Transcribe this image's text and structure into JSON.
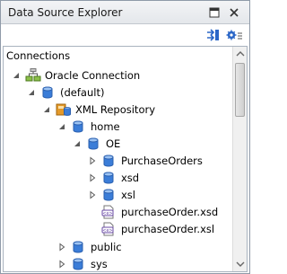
{
  "window": {
    "title": "Data Source Explorer",
    "minimize_icon": "minimize-icon",
    "close_icon": "close-icon"
  },
  "toolbar": {
    "items": [
      {
        "icon": "link-with-editor-icon"
      },
      {
        "icon": "view-settings-icon"
      }
    ]
  },
  "tree": {
    "header": "Connections",
    "nodes": [
      {
        "label": "Oracle Connection",
        "depth": 0,
        "state": "expanded",
        "icon": "oracle-connection-icon"
      },
      {
        "label": "(default)",
        "depth": 1,
        "state": "expanded",
        "icon": "database-icon"
      },
      {
        "label": "XML Repository",
        "depth": 2,
        "state": "expanded",
        "icon": "xml-repository-icon"
      },
      {
        "label": "home",
        "depth": 3,
        "state": "expanded",
        "icon": "database-icon"
      },
      {
        "label": "OE",
        "depth": 4,
        "state": "expanded",
        "icon": "database-icon"
      },
      {
        "label": "PurchaseOrders",
        "depth": 5,
        "state": "collapsed",
        "icon": "database-icon"
      },
      {
        "label": "xsd",
        "depth": 5,
        "state": "collapsed",
        "icon": "database-icon"
      },
      {
        "label": "xsl",
        "depth": 5,
        "state": "collapsed",
        "icon": "database-icon"
      },
      {
        "label": "purchaseOrder.xsd",
        "depth": 5,
        "state": "leaf",
        "icon": "xml-file-icon"
      },
      {
        "label": "purchaseOrder.xsl",
        "depth": 5,
        "state": "leaf",
        "icon": "xml-file-icon"
      },
      {
        "label": "public",
        "depth": 3,
        "state": "collapsed",
        "icon": "database-icon"
      },
      {
        "label": "sys",
        "depth": 3,
        "state": "collapsed",
        "icon": "database-icon"
      }
    ]
  },
  "colors": {
    "db_blue": "#3b7dd8",
    "arrow": "#5a5a5a",
    "xml_purple": "#6a4aa6",
    "repo_orange": "#e49a2a"
  }
}
